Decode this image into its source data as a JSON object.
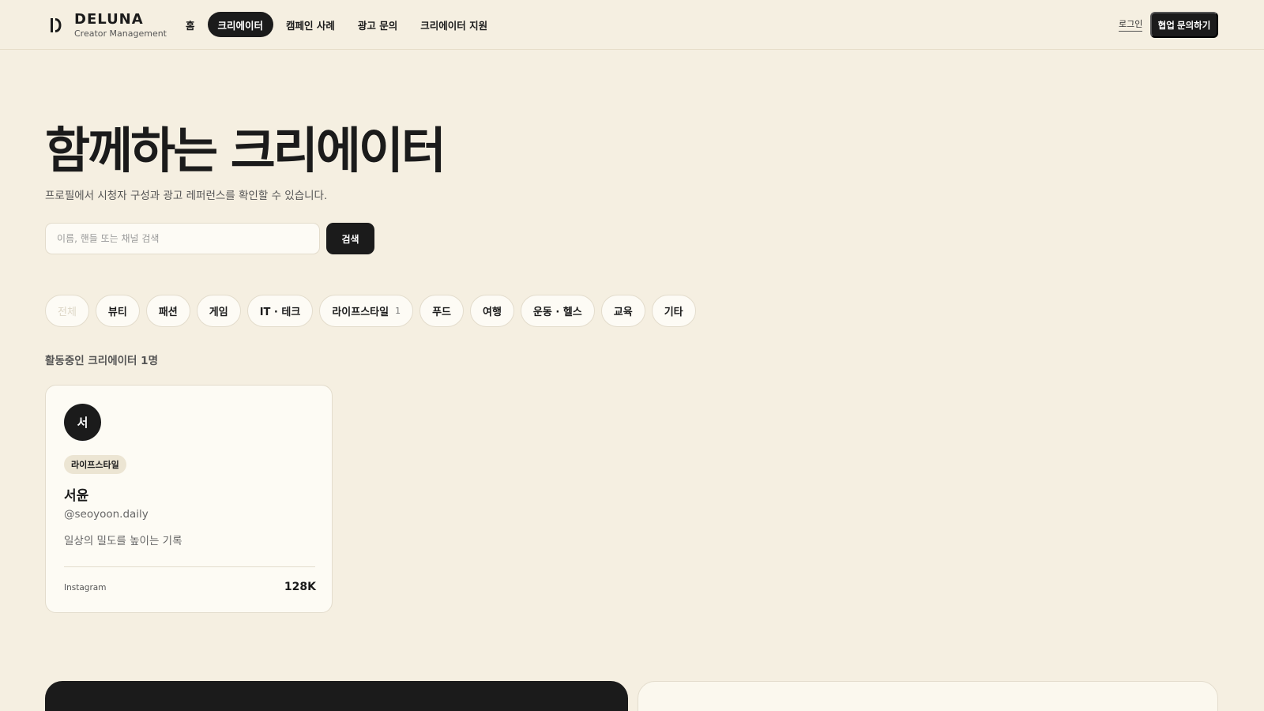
{
  "brand": {
    "name": "DELUNA",
    "subtitle": "Creator Management",
    "logo_icon": "deluna-logo-icon"
  },
  "nav": {
    "items": [
      {
        "label": "홈",
        "active": false
      },
      {
        "label": "크리에이터",
        "active": true
      },
      {
        "label": "캠페인 사례",
        "active": false
      },
      {
        "label": "광고 문의",
        "active": false
      },
      {
        "label": "크리에이터 지원",
        "active": false
      }
    ]
  },
  "header": {
    "login_label": "로그인",
    "cta_label": "협업 문의하기"
  },
  "hero": {
    "title": "함께하는 크리에이터",
    "subtitle": "프로필에서 시청자 구성과 광고 레퍼런스를 확인할 수 있습니다."
  },
  "search": {
    "placeholder": "이름, 핸들 또는 채널 검색",
    "value": "",
    "button_label": "검색"
  },
  "categories": {
    "items": [
      {
        "label": "전체",
        "count": ""
      },
      {
        "label": "뷰티",
        "count": ""
      },
      {
        "label": "패션",
        "count": ""
      },
      {
        "label": "게임",
        "count": ""
      },
      {
        "label": "IT · 테크",
        "count": ""
      },
      {
        "label": "라이프스타일",
        "count": "1"
      },
      {
        "label": "푸드",
        "count": ""
      },
      {
        "label": "여행",
        "count": ""
      },
      {
        "label": "운동 · 헬스",
        "count": ""
      },
      {
        "label": "교육",
        "count": ""
      },
      {
        "label": "기타",
        "count": ""
      }
    ]
  },
  "results": {
    "label": "활동중인 크리에이터 1명"
  },
  "creator": {
    "avatar_initial": "서",
    "category": "라이프스타일",
    "name": "서윤",
    "handle": "@seoyoon.daily",
    "description": "일상의 밀도를 높이는 기록",
    "platform": "Instagram",
    "followers": "128K"
  },
  "colors": {
    "background": "#f5efe1",
    "ink": "#1b1b1b",
    "card": "#fdfbf4",
    "tag": "#ece5d3",
    "border": "#e3dccc"
  }
}
